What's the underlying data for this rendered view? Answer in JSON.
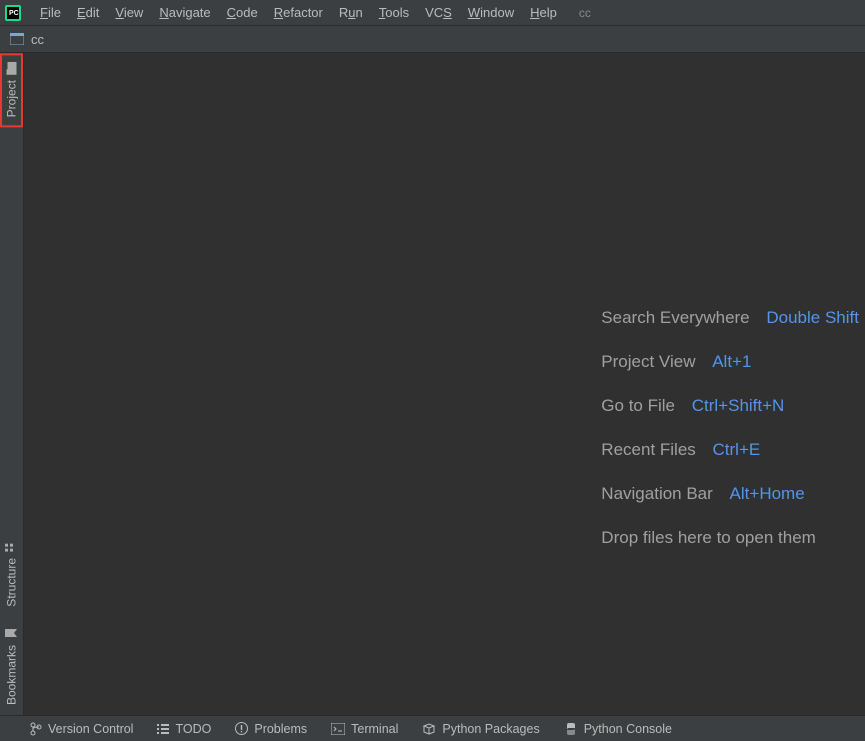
{
  "menubar": {
    "items": [
      {
        "label": "File",
        "u": 0
      },
      {
        "label": "Edit",
        "u": 0
      },
      {
        "label": "View",
        "u": 0
      },
      {
        "label": "Navigate",
        "u": 0
      },
      {
        "label": "Code",
        "u": 0
      },
      {
        "label": "Refactor",
        "u": 0
      },
      {
        "label": "Run",
        "u": 1
      },
      {
        "label": "Tools",
        "u": 0
      },
      {
        "label": "VCS",
        "u": 2
      },
      {
        "label": "Window",
        "u": 0
      },
      {
        "label": "Help",
        "u": 0
      }
    ],
    "soft_label": "cc"
  },
  "navbar": {
    "crumb_text": "cc",
    "icon": "window-icon"
  },
  "left_tool_buttons_top": [
    {
      "label": "Project",
      "icon": "folder-icon",
      "highlight": true
    }
  ],
  "left_tool_buttons_bottom": [
    {
      "label": "Structure",
      "icon": "structure-icon",
      "highlight": false
    },
    {
      "label": "Bookmarks",
      "icon": "bookmark-icon",
      "highlight": false
    }
  ],
  "hints": [
    {
      "label": "Search Everywhere",
      "shortcut": "Double Shift"
    },
    {
      "label": "Project View",
      "shortcut": "Alt+1"
    },
    {
      "label": "Go to File",
      "shortcut": "Ctrl+Shift+N"
    },
    {
      "label": "Recent Files",
      "shortcut": "Ctrl+E"
    },
    {
      "label": "Navigation Bar",
      "shortcut": "Alt+Home"
    }
  ],
  "hint_drop_text": "Drop files here to open them",
  "statusbar": {
    "items": [
      {
        "label": "Version Control",
        "icon": "vcs-branch-icon"
      },
      {
        "label": "TODO",
        "icon": "list-icon"
      },
      {
        "label": "Problems",
        "icon": "alert-icon"
      },
      {
        "label": "Terminal",
        "icon": "terminal-icon"
      },
      {
        "label": "Python Packages",
        "icon": "packages-icon"
      },
      {
        "label": "Python Console",
        "icon": "python-icon"
      }
    ]
  },
  "colors": {
    "accent": "#5394ec",
    "highlight_outline": "#e53935",
    "bg_editor": "#303030",
    "bg_chrome": "#3c3f41"
  }
}
